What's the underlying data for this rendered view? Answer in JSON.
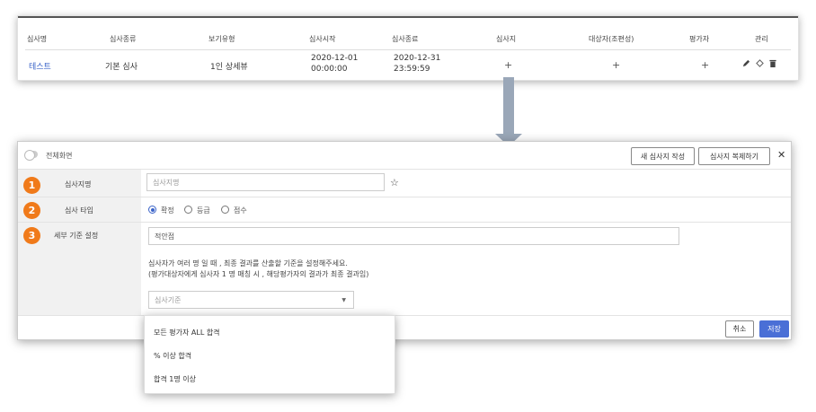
{
  "table": {
    "headers": [
      "심사명",
      "심사종류",
      "보기유형",
      "심사시작",
      "심사종료",
      "심사지",
      "대상자(조편성)",
      "평가자",
      "관리"
    ],
    "row": {
      "name": "테스트",
      "type": "기본 심사",
      "view_type": "1인 상세뷰",
      "start_date": "2020-12-01",
      "start_time": "00:00:00",
      "end_date": "2020-12-31",
      "end_time": "23:59:59",
      "sheet_action": "+",
      "target_action": "+",
      "evaluator_action": "+"
    }
  },
  "dialog": {
    "fullscreen_label": "전체화면",
    "new_sheet_button": "새 심사지 작성",
    "copy_sheet_button": "심사지 복제하기",
    "close_icon": "✕",
    "rows": [
      {
        "num": "1",
        "label": "심사지명"
      },
      {
        "num": "2",
        "label": "심사 타입"
      },
      {
        "num": "3",
        "label": "세부 기준 설정"
      }
    ],
    "sheet_name_placeholder": "심사지명",
    "star_icon": "☆",
    "type_options": [
      "확정",
      "등급",
      "점수"
    ],
    "selected_type": "확정",
    "detail_value": "적안점",
    "description_line1": "심사자가 여러 명 일 때 , 최종 결과를 산출할 기준을 설정해주세요.",
    "description_line2": "(평가대상자에게 심사자 1 명 매칭 시 , 해당평가자의 결과가 최종 결과임)",
    "criteria_placeholder": "심사기준",
    "cancel_button": "취소",
    "save_button": "저장"
  },
  "dropdown_options": [
    "모든 평가자 ALL 합격",
    "% 이상 합격",
    "합격 1명 이상"
  ],
  "colors": {
    "accent": "#3a63c8",
    "badge": "#f07a1a",
    "arrow": "#9aa7b8"
  }
}
